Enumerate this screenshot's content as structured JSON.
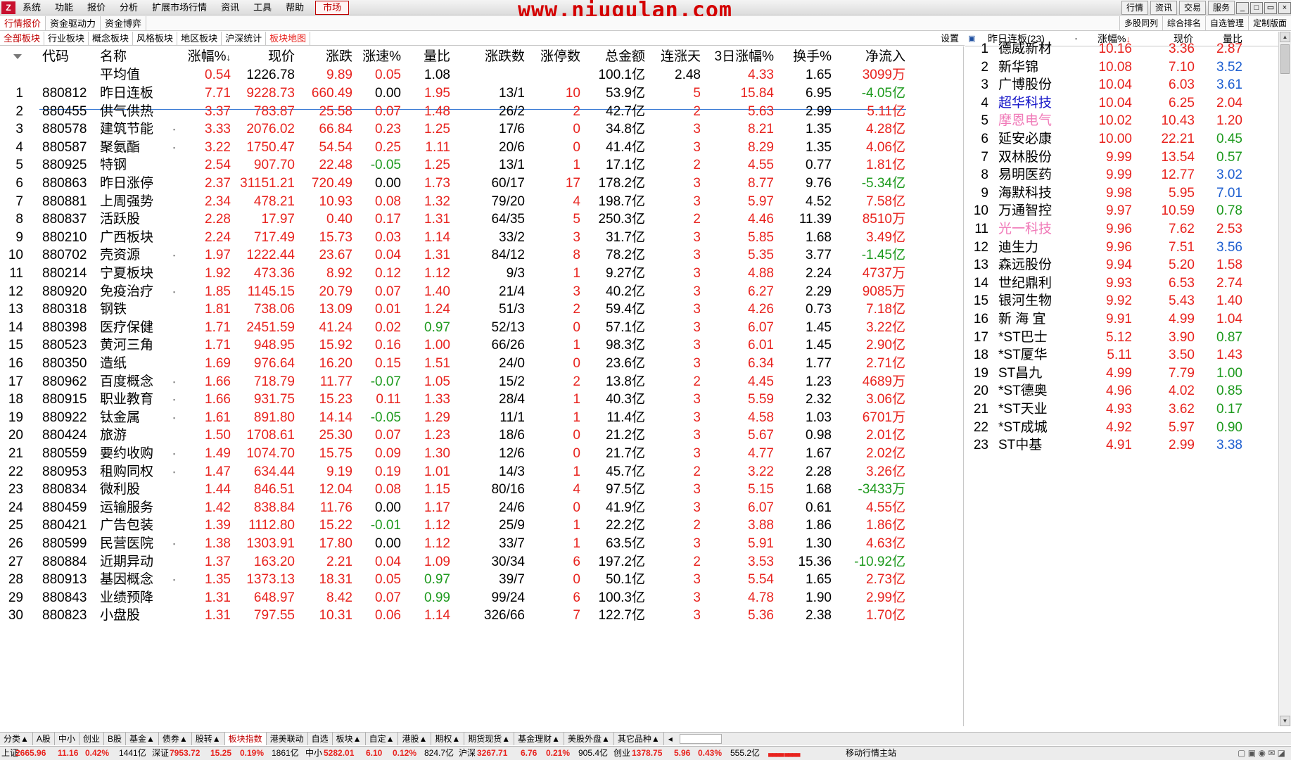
{
  "menubar": {
    "logo": "Z",
    "items": [
      "系统",
      "功能",
      "报价",
      "分析",
      "扩展市场行情",
      "资讯",
      "工具",
      "帮助"
    ],
    "market": "市场",
    "watermark": "www.niugulan.com",
    "right_buttons": [
      "行情",
      "资讯",
      "交易",
      "服务"
    ],
    "window_controls": [
      "_",
      "□",
      "▭",
      "×"
    ]
  },
  "subbar": {
    "tabs": [
      "行情报价",
      "资金驱动力",
      "资金博弈"
    ],
    "active_index": 0,
    "right_tabs": [
      "多股同列",
      "综合排名",
      "自选管理",
      "定制版面"
    ]
  },
  "catbar": {
    "tabs": [
      "全部板块",
      "行业板块",
      "概念板块",
      "风格板块",
      "地区板块",
      "沪深统计",
      "板块地图"
    ],
    "active_index": 0,
    "settings": "设置"
  },
  "table": {
    "headers": {
      "code": "代码",
      "name": "名称",
      "pct": "涨幅%",
      "price": "现价",
      "chg": "涨跌",
      "speed": "涨速%",
      "vr": "量比",
      "ud": "涨跌数",
      "limit": "涨停数",
      "amt": "总金额",
      "days": "连涨天",
      "pct3d": "3日涨幅%",
      "turn": "换手%",
      "flow": "净流入"
    },
    "sort_arrow": "↓",
    "average": {
      "name": "平均值",
      "pct": "0.54",
      "price": "1226.78",
      "chg": "9.89",
      "speed": "0.05",
      "vr": "1.08",
      "amt": "100.1亿",
      "days": "2.48",
      "pct3d": "4.33",
      "turn": "1.65",
      "flow": "3099万"
    },
    "rows": [
      {
        "no": "1",
        "code": "880812",
        "name": "昨日连板",
        "dot": "",
        "pct": "7.71",
        "price": "9228.73",
        "chg": "660.49",
        "speed": "0.00",
        "vr": "1.95",
        "ud": "13/1",
        "limit": "10",
        "amt": "53.9亿",
        "days": "5",
        "pct3d": "15.84",
        "turn": "6.95",
        "flow": "-4.05亿"
      },
      {
        "no": "2",
        "code": "880455",
        "name": "供气供热",
        "dot": "",
        "pct": "3.37",
        "price": "783.87",
        "chg": "25.58",
        "speed": "0.07",
        "vr": "1.48",
        "ud": "26/2",
        "limit": "2",
        "amt": "42.7亿",
        "days": "2",
        "pct3d": "5.63",
        "turn": "2.99",
        "flow": "5.11亿"
      },
      {
        "no": "3",
        "code": "880578",
        "name": "建筑节能",
        "dot": "▪",
        "pct": "3.33",
        "price": "2076.02",
        "chg": "66.84",
        "speed": "0.23",
        "vr": "1.25",
        "ud": "17/6",
        "limit": "0",
        "amt": "34.8亿",
        "days": "3",
        "pct3d": "8.21",
        "turn": "1.35",
        "flow": "4.28亿"
      },
      {
        "no": "4",
        "code": "880587",
        "name": "聚氨酯",
        "dot": "▪",
        "pct": "3.22",
        "price": "1750.47",
        "chg": "54.54",
        "speed": "0.25",
        "vr": "1.11",
        "ud": "20/6",
        "limit": "0",
        "amt": "41.4亿",
        "days": "3",
        "pct3d": "8.29",
        "turn": "1.35",
        "flow": "4.06亿"
      },
      {
        "no": "5",
        "code": "880925",
        "name": "特钢",
        "dot": "",
        "pct": "2.54",
        "price": "907.70",
        "chg": "22.48",
        "speed": "-0.05",
        "vr": "1.25",
        "ud": "13/1",
        "limit": "1",
        "amt": "17.1亿",
        "days": "2",
        "pct3d": "4.55",
        "turn": "0.77",
        "flow": "1.81亿"
      },
      {
        "no": "6",
        "code": "880863",
        "name": "昨日涨停",
        "dot": "",
        "pct": "2.37",
        "price": "31151.21",
        "chg": "720.49",
        "speed": "0.00",
        "vr": "1.73",
        "ud": "60/17",
        "limit": "17",
        "amt": "178.2亿",
        "days": "3",
        "pct3d": "8.77",
        "turn": "9.76",
        "flow": "-5.34亿"
      },
      {
        "no": "7",
        "code": "880881",
        "name": "上周强势",
        "dot": "",
        "pct": "2.34",
        "price": "478.21",
        "chg": "10.93",
        "speed": "0.08",
        "vr": "1.32",
        "ud": "79/20",
        "limit": "4",
        "amt": "198.7亿",
        "days": "3",
        "pct3d": "5.97",
        "turn": "4.52",
        "flow": "7.58亿"
      },
      {
        "no": "8",
        "code": "880837",
        "name": "活跃股",
        "dot": "",
        "pct": "2.28",
        "price": "17.97",
        "chg": "0.40",
        "speed": "0.17",
        "vr": "1.31",
        "ud": "64/35",
        "limit": "5",
        "amt": "250.3亿",
        "days": "2",
        "pct3d": "4.46",
        "turn": "11.39",
        "flow": "8510万"
      },
      {
        "no": "9",
        "code": "880210",
        "name": "广西板块",
        "dot": "",
        "pct": "2.24",
        "price": "717.49",
        "chg": "15.73",
        "speed": "0.03",
        "vr": "1.14",
        "ud": "33/2",
        "limit": "3",
        "amt": "31.7亿",
        "days": "3",
        "pct3d": "5.85",
        "turn": "1.68",
        "flow": "3.49亿"
      },
      {
        "no": "10",
        "code": "880702",
        "name": "壳资源",
        "dot": "▪",
        "pct": "1.97",
        "price": "1222.44",
        "chg": "23.67",
        "speed": "0.04",
        "vr": "1.31",
        "ud": "84/12",
        "limit": "8",
        "amt": "78.2亿",
        "days": "3",
        "pct3d": "5.35",
        "turn": "3.77",
        "flow": "-1.45亿"
      },
      {
        "no": "11",
        "code": "880214",
        "name": "宁夏板块",
        "dot": "",
        "pct": "1.92",
        "price": "473.36",
        "chg": "8.92",
        "speed": "0.12",
        "vr": "1.12",
        "ud": "9/3",
        "limit": "1",
        "amt": "9.27亿",
        "days": "3",
        "pct3d": "4.88",
        "turn": "2.24",
        "flow": "4737万"
      },
      {
        "no": "12",
        "code": "880920",
        "name": "免疫治疗",
        "dot": "▪",
        "pct": "1.85",
        "price": "1145.15",
        "chg": "20.79",
        "speed": "0.07",
        "vr": "1.40",
        "ud": "21/4",
        "limit": "3",
        "amt": "40.2亿",
        "days": "3",
        "pct3d": "6.27",
        "turn": "2.29",
        "flow": "9085万"
      },
      {
        "no": "13",
        "code": "880318",
        "name": "钢铁",
        "dot": "",
        "pct": "1.81",
        "price": "738.06",
        "chg": "13.09",
        "speed": "0.01",
        "vr": "1.24",
        "ud": "51/3",
        "limit": "2",
        "amt": "59.4亿",
        "days": "3",
        "pct3d": "4.26",
        "turn": "0.73",
        "flow": "7.18亿"
      },
      {
        "no": "14",
        "code": "880398",
        "name": "医疗保健",
        "dot": "",
        "pct": "1.71",
        "price": "2451.59",
        "chg": "41.24",
        "speed": "0.02",
        "vr": "0.97",
        "ud": "52/13",
        "limit": "0",
        "amt": "57.1亿",
        "days": "3",
        "pct3d": "6.07",
        "turn": "1.45",
        "flow": "3.22亿"
      },
      {
        "no": "15",
        "code": "880523",
        "name": "黄河三角",
        "dot": "",
        "pct": "1.71",
        "price": "948.95",
        "chg": "15.92",
        "speed": "0.16",
        "vr": "1.00",
        "ud": "66/26",
        "limit": "1",
        "amt": "98.3亿",
        "days": "3",
        "pct3d": "6.01",
        "turn": "1.45",
        "flow": "2.90亿"
      },
      {
        "no": "16",
        "code": "880350",
        "name": "造纸",
        "dot": "",
        "pct": "1.69",
        "price": "976.64",
        "chg": "16.20",
        "speed": "0.15",
        "vr": "1.51",
        "ud": "24/0",
        "limit": "0",
        "amt": "23.6亿",
        "days": "3",
        "pct3d": "6.34",
        "turn": "1.77",
        "flow": "2.71亿"
      },
      {
        "no": "17",
        "code": "880962",
        "name": "百度概念",
        "dot": "▪",
        "pct": "1.66",
        "price": "718.79",
        "chg": "11.77",
        "speed": "-0.07",
        "vr": "1.05",
        "ud": "15/2",
        "limit": "2",
        "amt": "13.8亿",
        "days": "2",
        "pct3d": "4.45",
        "turn": "1.23",
        "flow": "4689万"
      },
      {
        "no": "18",
        "code": "880915",
        "name": "职业教育",
        "dot": "▪",
        "pct": "1.66",
        "price": "931.75",
        "chg": "15.23",
        "speed": "0.11",
        "vr": "1.33",
        "ud": "28/4",
        "limit": "1",
        "amt": "40.3亿",
        "days": "3",
        "pct3d": "5.59",
        "turn": "2.32",
        "flow": "3.06亿"
      },
      {
        "no": "19",
        "code": "880922",
        "name": "钛金属",
        "dot": "▪",
        "pct": "1.61",
        "price": "891.80",
        "chg": "14.14",
        "speed": "-0.05",
        "vr": "1.29",
        "ud": "11/1",
        "limit": "1",
        "amt": "11.4亿",
        "days": "3",
        "pct3d": "4.58",
        "turn": "1.03",
        "flow": "6701万"
      },
      {
        "no": "20",
        "code": "880424",
        "name": "旅游",
        "dot": "",
        "pct": "1.50",
        "price": "1708.61",
        "chg": "25.30",
        "speed": "0.07",
        "vr": "1.23",
        "ud": "18/6",
        "limit": "0",
        "amt": "21.2亿",
        "days": "3",
        "pct3d": "5.67",
        "turn": "0.98",
        "flow": "2.01亿"
      },
      {
        "no": "21",
        "code": "880559",
        "name": "要约收购",
        "dot": "▪",
        "pct": "1.49",
        "price": "1074.70",
        "chg": "15.75",
        "speed": "0.09",
        "vr": "1.30",
        "ud": "12/6",
        "limit": "0",
        "amt": "21.7亿",
        "days": "3",
        "pct3d": "4.77",
        "turn": "1.67",
        "flow": "2.02亿"
      },
      {
        "no": "22",
        "code": "880953",
        "name": "租购同权",
        "dot": "▪",
        "pct": "1.47",
        "price": "634.44",
        "chg": "9.19",
        "speed": "0.19",
        "vr": "1.01",
        "ud": "14/3",
        "limit": "1",
        "amt": "45.7亿",
        "days": "2",
        "pct3d": "3.22",
        "turn": "2.28",
        "flow": "3.26亿"
      },
      {
        "no": "23",
        "code": "880834",
        "name": "微利股",
        "dot": "",
        "pct": "1.44",
        "price": "846.51",
        "chg": "12.04",
        "speed": "0.08",
        "vr": "1.15",
        "ud": "80/16",
        "limit": "4",
        "amt": "97.5亿",
        "days": "3",
        "pct3d": "5.15",
        "turn": "1.68",
        "flow": "-3433万"
      },
      {
        "no": "24",
        "code": "880459",
        "name": "运输服务",
        "dot": "",
        "pct": "1.42",
        "price": "838.84",
        "chg": "11.76",
        "speed": "0.00",
        "vr": "1.17",
        "ud": "24/6",
        "limit": "0",
        "amt": "41.9亿",
        "days": "3",
        "pct3d": "6.07",
        "turn": "0.61",
        "flow": "4.55亿"
      },
      {
        "no": "25",
        "code": "880421",
        "name": "广告包装",
        "dot": "",
        "pct": "1.39",
        "price": "1112.80",
        "chg": "15.22",
        "speed": "-0.01",
        "vr": "1.12",
        "ud": "25/9",
        "limit": "1",
        "amt": "22.2亿",
        "days": "2",
        "pct3d": "3.88",
        "turn": "1.86",
        "flow": "1.86亿"
      },
      {
        "no": "26",
        "code": "880599",
        "name": "民营医院",
        "dot": "▪",
        "pct": "1.38",
        "price": "1303.91",
        "chg": "17.80",
        "speed": "0.00",
        "vr": "1.12",
        "ud": "33/7",
        "limit": "1",
        "amt": "63.5亿",
        "days": "3",
        "pct3d": "5.91",
        "turn": "1.30",
        "flow": "4.63亿"
      },
      {
        "no": "27",
        "code": "880884",
        "name": "近期异动",
        "dot": "",
        "pct": "1.37",
        "price": "163.20",
        "chg": "2.21",
        "speed": "0.04",
        "vr": "1.09",
        "ud": "30/34",
        "limit": "6",
        "amt": "197.2亿",
        "days": "2",
        "pct3d": "3.53",
        "turn": "15.36",
        "flow": "-10.92亿"
      },
      {
        "no": "28",
        "code": "880913",
        "name": "基因概念",
        "dot": "▪",
        "pct": "1.35",
        "price": "1373.13",
        "chg": "18.31",
        "speed": "0.05",
        "vr": "0.97",
        "ud": "39/7",
        "limit": "0",
        "amt": "50.1亿",
        "days": "3",
        "pct3d": "5.54",
        "turn": "1.65",
        "flow": "2.73亿"
      },
      {
        "no": "29",
        "code": "880843",
        "name": "业绩预降",
        "dot": "",
        "pct": "1.31",
        "price": "648.97",
        "chg": "8.42",
        "speed": "0.07",
        "vr": "0.99",
        "ud": "99/24",
        "limit": "6",
        "amt": "100.3亿",
        "days": "3",
        "pct3d": "4.78",
        "turn": "1.90",
        "flow": "2.99亿"
      },
      {
        "no": "30",
        "code": "880823",
        "name": "小盘股",
        "dot": "",
        "pct": "1.31",
        "price": "797.55",
        "chg": "10.31",
        "speed": "0.06",
        "vr": "1.14",
        "ud": "326/66",
        "limit": "7",
        "amt": "122.7亿",
        "days": "3",
        "pct3d": "5.36",
        "turn": "2.38",
        "flow": "1.70亿"
      }
    ]
  },
  "side": {
    "icon": "▣",
    "title": "昨日连板(23)",
    "dot": "▪",
    "headers": {
      "pct": "涨幅%",
      "price": "现价",
      "vr": "量比"
    },
    "sort_arrow": "↓",
    "rows": [
      {
        "no": "1",
        "name": "德威新材",
        "pct": "10.16",
        "price": "3.36",
        "vr": "2.87",
        "ncolor": "",
        "vcolor": "red"
      },
      {
        "no": "2",
        "name": "新华锦",
        "pct": "10.08",
        "price": "7.10",
        "vr": "3.52",
        "ncolor": "",
        "vcolor": "blue"
      },
      {
        "no": "3",
        "name": "广博股份",
        "pct": "10.04",
        "price": "6.03",
        "vr": "3.61",
        "ncolor": "",
        "vcolor": "blue"
      },
      {
        "no": "4",
        "name": "超华科技",
        "pct": "10.04",
        "price": "6.25",
        "vr": "2.04",
        "ncolor": "dblue",
        "vcolor": "red"
      },
      {
        "no": "5",
        "name": "摩恩电气",
        "pct": "10.02",
        "price": "10.43",
        "vr": "1.20",
        "ncolor": "pink",
        "vcolor": "red"
      },
      {
        "no": "6",
        "name": "延安必康",
        "pct": "10.00",
        "price": "22.21",
        "vr": "0.45",
        "ncolor": "",
        "vcolor": "green"
      },
      {
        "no": "7",
        "name": "双林股份",
        "pct": "9.99",
        "price": "13.54",
        "vr": "0.57",
        "ncolor": "",
        "vcolor": "green"
      },
      {
        "no": "8",
        "name": "易明医药",
        "pct": "9.99",
        "price": "12.77",
        "vr": "3.02",
        "ncolor": "",
        "vcolor": "blue"
      },
      {
        "no": "9",
        "name": "海默科技",
        "pct": "9.98",
        "price": "5.95",
        "vr": "7.01",
        "ncolor": "",
        "vcolor": "blue"
      },
      {
        "no": "10",
        "name": "万通智控",
        "pct": "9.97",
        "price": "10.59",
        "vr": "0.78",
        "ncolor": "",
        "vcolor": "green"
      },
      {
        "no": "11",
        "name": "光一科技",
        "pct": "9.96",
        "price": "7.62",
        "vr": "2.53",
        "ncolor": "pink",
        "vcolor": "red"
      },
      {
        "no": "12",
        "name": "迪生力",
        "pct": "9.96",
        "price": "7.51",
        "vr": "3.56",
        "ncolor": "",
        "vcolor": "blue"
      },
      {
        "no": "13",
        "name": "森远股份",
        "pct": "9.94",
        "price": "5.20",
        "vr": "1.58",
        "ncolor": "",
        "vcolor": "red"
      },
      {
        "no": "14",
        "name": "世纪鼎利",
        "pct": "9.93",
        "price": "6.53",
        "vr": "2.74",
        "ncolor": "",
        "vcolor": "red"
      },
      {
        "no": "15",
        "name": "银河生物",
        "pct": "9.92",
        "price": "5.43",
        "vr": "1.40",
        "ncolor": "",
        "vcolor": "red"
      },
      {
        "no": "16",
        "name": "新 海 宜",
        "pct": "9.91",
        "price": "4.99",
        "vr": "1.04",
        "ncolor": "",
        "vcolor": "red"
      },
      {
        "no": "17",
        "name": "*ST巴士",
        "pct": "5.12",
        "price": "3.90",
        "vr": "0.87",
        "ncolor": "",
        "vcolor": "green"
      },
      {
        "no": "18",
        "name": "*ST厦华",
        "pct": "5.11",
        "price": "3.50",
        "vr": "1.43",
        "ncolor": "",
        "vcolor": "red"
      },
      {
        "no": "19",
        "name": "ST昌九",
        "pct": "4.99",
        "price": "7.79",
        "vr": "1.00",
        "ncolor": "",
        "vcolor": "green"
      },
      {
        "no": "20",
        "name": "*ST德奥",
        "pct": "4.96",
        "price": "4.02",
        "vr": "0.85",
        "ncolor": "",
        "vcolor": "green"
      },
      {
        "no": "21",
        "name": "*ST天业",
        "pct": "4.93",
        "price": "3.62",
        "vr": "0.17",
        "ncolor": "",
        "vcolor": "green"
      },
      {
        "no": "22",
        "name": "*ST成城",
        "pct": "4.92",
        "price": "5.97",
        "vr": "0.90",
        "ncolor": "",
        "vcolor": "green"
      },
      {
        "no": "23",
        "name": "ST中基",
        "pct": "4.91",
        "price": "2.99",
        "vr": "3.38",
        "ncolor": "",
        "vcolor": "blue"
      }
    ]
  },
  "bottom_tabs": {
    "tabs": [
      "分类▲",
      "A股",
      "中小",
      "创业",
      "B股",
      "基金▲",
      "债券▲",
      "股转▲",
      "板块指数",
      "港美联动",
      "自选",
      "板块▲",
      "自定▲",
      "港股▲",
      "期权▲",
      "期货现货▲",
      "基金理财▲",
      "美股外盘▲",
      "其它品种▲"
    ],
    "active_index": 8,
    "nav": "◂"
  },
  "statusbar": {
    "sh_label": "上证",
    "sh_val": "2665.96",
    "sh_chg": "11.16",
    "sh_pct": "0.42%",
    "sh_amt": "1441亿",
    "sz_label": "深证",
    "sz_val": "7953.72",
    "sz_chg": "15.25",
    "sz_pct": "0.19%",
    "sz_amt": "1861亿",
    "zx_label": "中小",
    "zx_val": "5282.01",
    "zx_chg": "6.10",
    "zx_pct": "0.12%",
    "zx_amt": "824.7亿",
    "hs_label": "沪深",
    "hs_val": "3267.71",
    "hs_chg": "6.76",
    "hs_pct": "0.21%",
    "hs_amt": "905.4亿",
    "cy_label": "创业",
    "cy_val": "1378.75",
    "cy_chg": "5.96",
    "cy_pct": "0.43%",
    "cy_amt": "555.2亿",
    "bars": "▄▄▄▄ ▄▄▄▄",
    "site": "移动行情主站",
    "icons": "▢ ▣ ◉ ✉ ◪"
  }
}
